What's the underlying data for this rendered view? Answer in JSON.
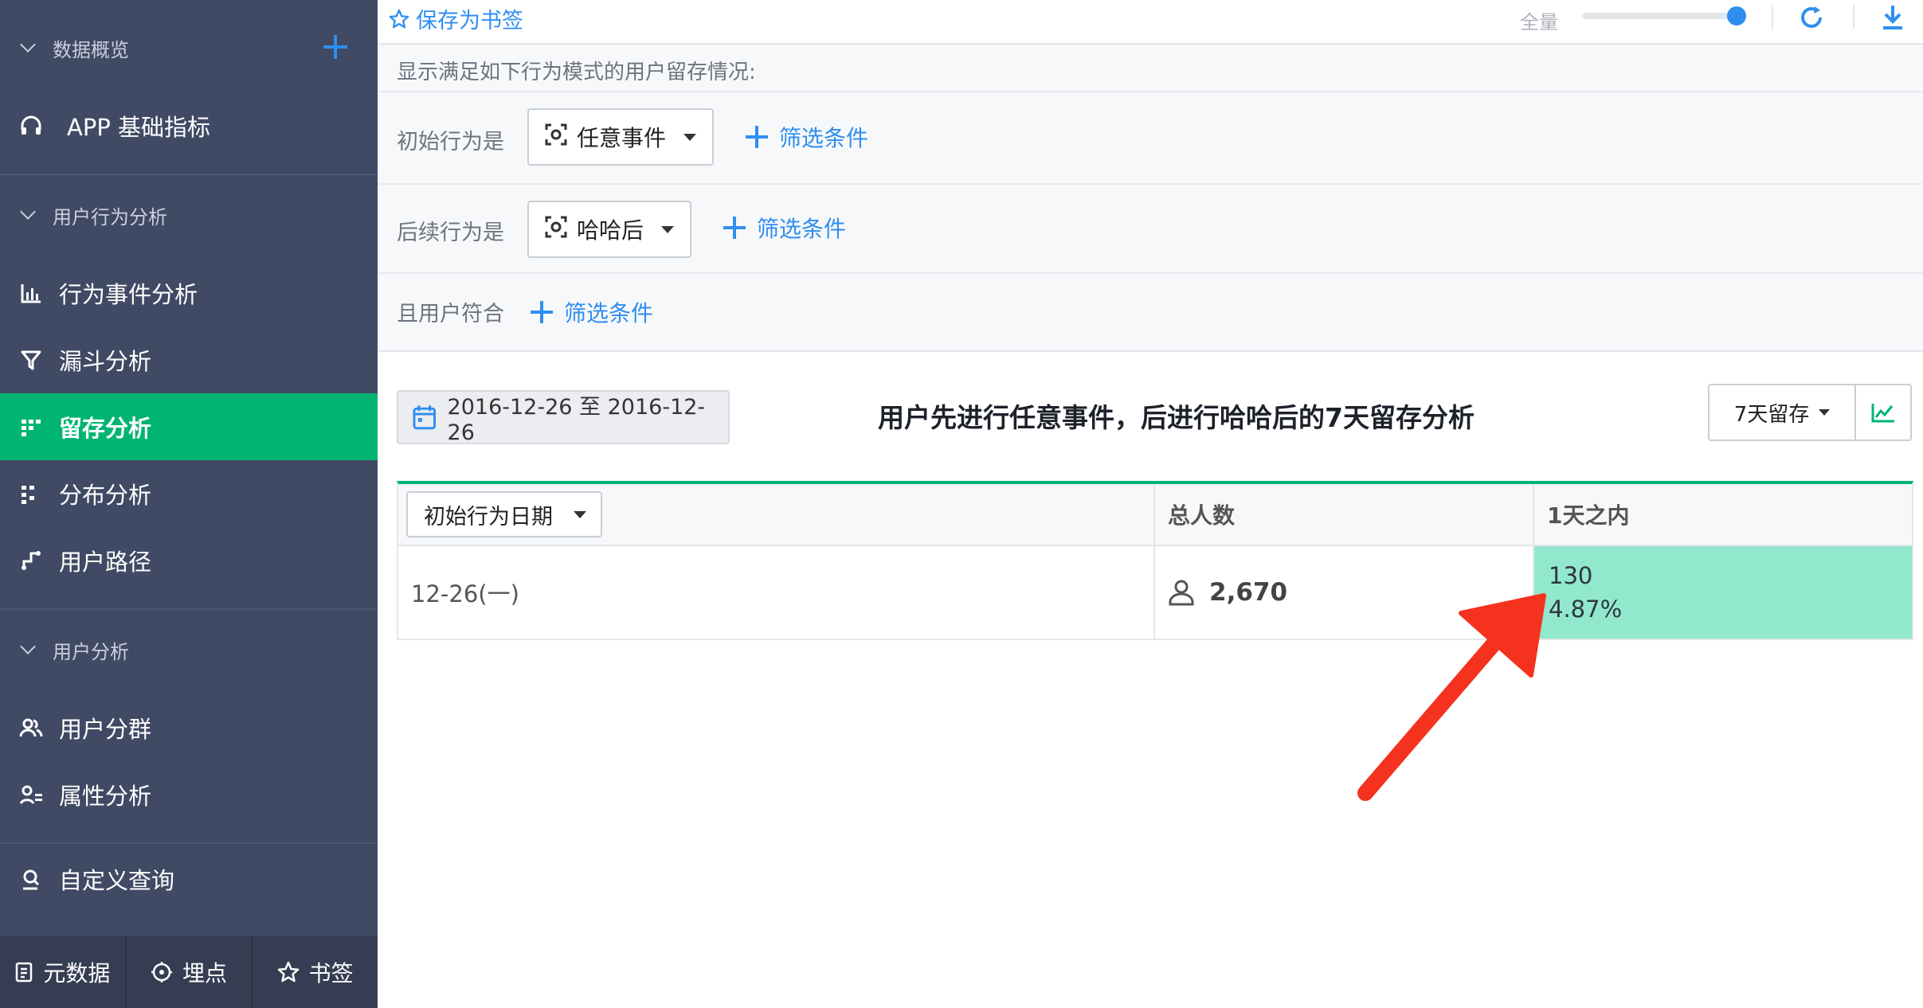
{
  "sidebar": {
    "sections": [
      {
        "label": "数据概览"
      },
      {
        "label": "用户行为分析"
      },
      {
        "label": "用户分析"
      }
    ],
    "items": [
      {
        "label": "APP 基础指标",
        "icon": "headphones-icon"
      },
      {
        "label": "行为事件分析",
        "icon": "bar-chart-icon"
      },
      {
        "label": "漏斗分析",
        "icon": "funnel-icon"
      },
      {
        "label": "留存分析",
        "icon": "retention-grid-icon",
        "active": true
      },
      {
        "label": "分布分析",
        "icon": "distribution-icon"
      },
      {
        "label": "用户路径",
        "icon": "path-icon"
      },
      {
        "label": "用户分群",
        "icon": "users-group-icon"
      },
      {
        "label": "属性分析",
        "icon": "user-attribute-icon"
      },
      {
        "label": "自定义查询",
        "icon": "search-user-icon"
      }
    ],
    "bottom": [
      {
        "label": "元数据",
        "icon": "document-icon"
      },
      {
        "label": "埋点",
        "icon": "target-icon"
      },
      {
        "label": "书签",
        "icon": "star-icon"
      }
    ]
  },
  "topbar": {
    "bookmark_label": "保存为书签",
    "full_label": "全量",
    "slider_value": 1.0
  },
  "filters": {
    "intro": "显示满足如下行为模式的用户留存情况:",
    "initial_label": "初始行为是",
    "initial_event": "任意事件",
    "subsequent_label": "后续行为是",
    "subsequent_event": "哈哈后",
    "user_label": "且用户符合",
    "add_filter_label": "筛选条件"
  },
  "results": {
    "date_range": "2016-12-26 至 2016-12-26",
    "title": "用户先进行任意事件，后进行哈哈后的7天留存分析",
    "retention_period": "7天留存",
    "table": {
      "date_dimension": "初始行为日期",
      "total_header": "总人数",
      "day1_header": "1天之内",
      "rows": [
        {
          "date": "12-26(一)",
          "total": "2,670",
          "day1_count": "130",
          "day1_rate": "4.87%"
        }
      ]
    }
  },
  "colors": {
    "sidebar_bg": "#404a64",
    "active_green": "#00b473",
    "link_blue": "#2f8ef0",
    "retention_cell": "#91e8cc",
    "annotation_red": "#f5321e"
  }
}
